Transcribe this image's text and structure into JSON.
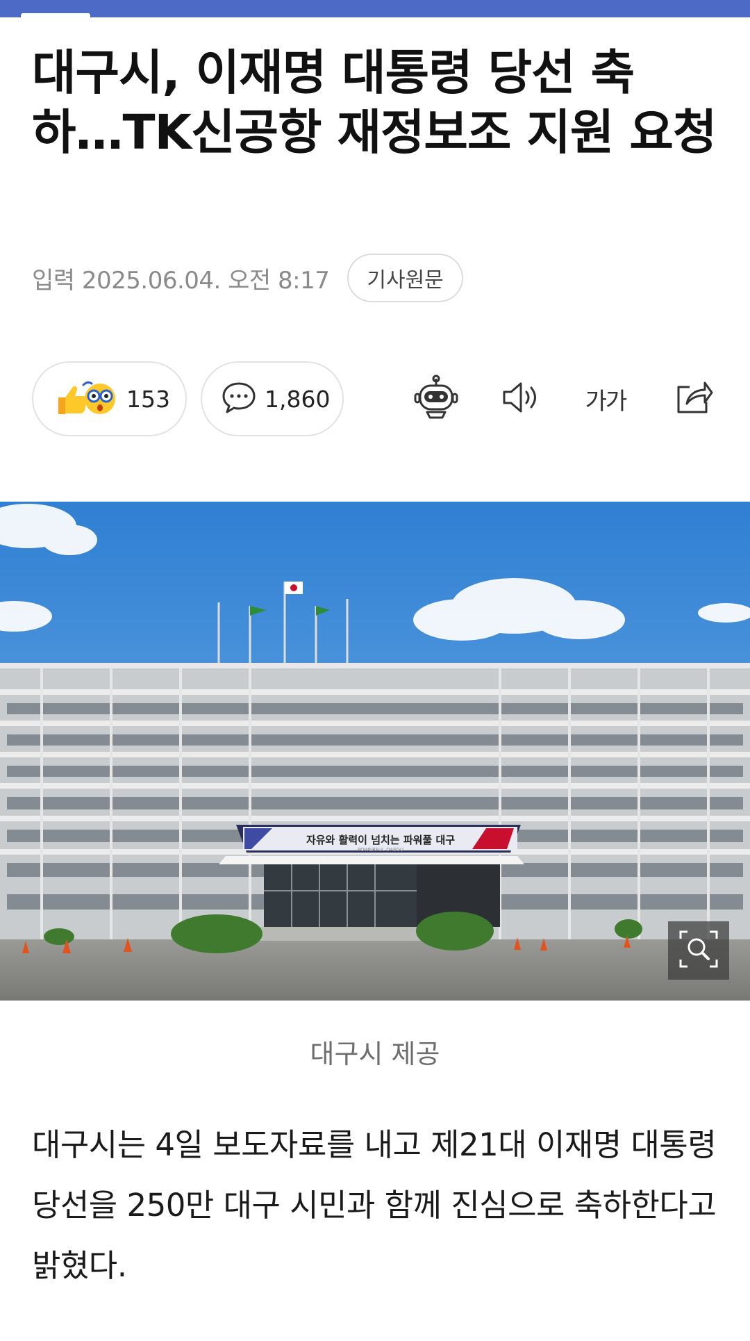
{
  "article": {
    "headline": "대구시, 이재명 대통령 당선 축하…TK신공항 재정보조 지원 요청",
    "published": "입력 2025.06.04. 오전 8:17",
    "source_button": "기사원문",
    "reactions": {
      "count": "153",
      "icon": "thumbs-up-and-surprised-face-icon"
    },
    "comments": {
      "count": "1,860",
      "icon": "speech-bubble-icon"
    },
    "toolbar": {
      "summary_icon": "robot-icon",
      "tts_icon": "speaker-icon",
      "font_size_label": "가가",
      "share_icon": "share-icon"
    },
    "photo": {
      "banner_text": "자유와 활력이 넘치는 파워풀 대구",
      "banner_subtext": "POWERFUL DAEGU",
      "zoom_icon": "zoom-magnifier-icon"
    },
    "caption": "대구시 제공",
    "body": "대구시는 4일 보도자료를 내고 제21대 이재명 대통령 당선을 250만 대구 시민과 함께 진심으로 축하한다고 밝혔다."
  },
  "colors": {
    "topbar": "#4d6bc6",
    "meta_text": "#8a8a8a",
    "caption_text": "#6d6d6d"
  }
}
